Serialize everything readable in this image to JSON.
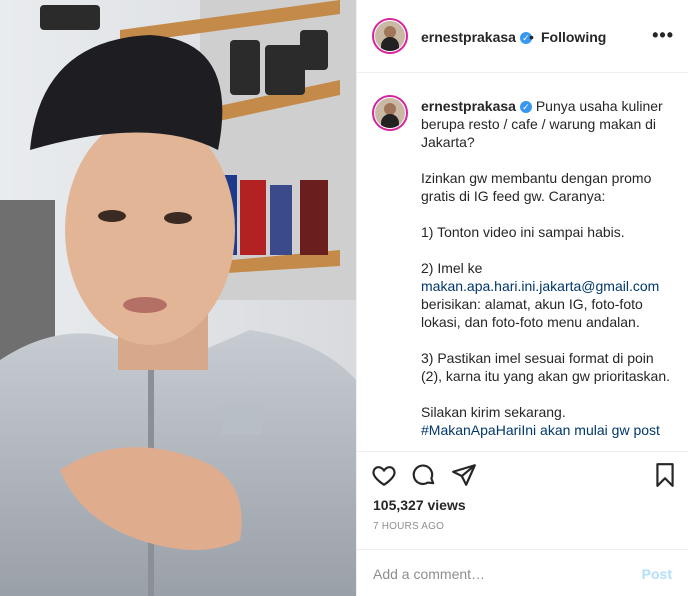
{
  "post": {
    "username": "ernestprakasa",
    "verified_icon": "verified-badge-icon",
    "separator": "•",
    "follow_status": "Following",
    "more_label": "•••",
    "caption_username": "ernestprakasa",
    "caption_intro": "Punya usaha kuliner berupa resto / cafe / warung makan di Jakarta?",
    "caption_p2": "Izinkan gw membantu dengan promo gratis di IG feed gw. Caranya:",
    "caption_p3": "1) Tonton video ini sampai habis.",
    "caption_p4a": "2) Imel ke",
    "caption_email": "makan.apa.hari.ini.jakarta@gmail.com",
    "caption_p4b": "berisikan: alamat, akun IG, foto-foto lokasi, dan foto-foto menu andalan.",
    "caption_p5": "3) Pastikan imel sesuai format di poin (2), karna itu yang akan gw prioritaskan.",
    "caption_p6": "Silakan kirim sekarang.",
    "caption_p7": "#MakanApaHariIni akan mulai gw post",
    "views": "105,327 views",
    "time": "7 HOURS AGO",
    "comment_placeholder": "Add a comment…",
    "post_label": "Post"
  },
  "colors": {
    "link": "#00376b",
    "verified": "#3897f0",
    "muted": "#8e8e8e",
    "post_disabled": "#b2dffc"
  }
}
